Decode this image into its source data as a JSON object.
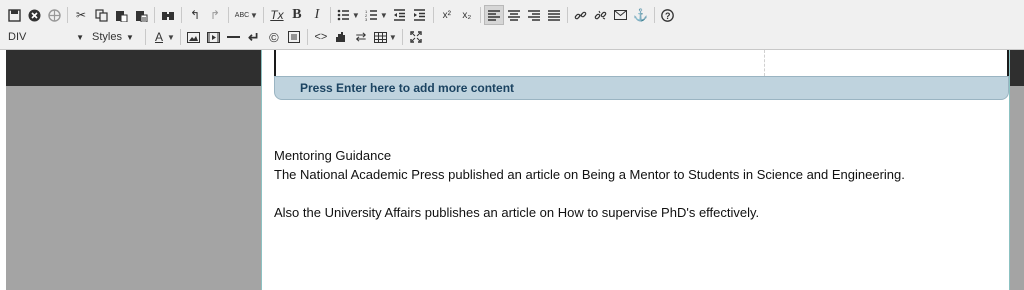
{
  "toolbar": {
    "format_combo": "DIV",
    "styles_combo": "Styles",
    "spellcheck_glyph": "ABC",
    "text_color_glyph": "A",
    "superscript_glyph": "x²",
    "subscript_glyph": "x₂",
    "bold_glyph": "B",
    "italic_glyph": "I",
    "clear_format_glyph": "Tx",
    "icons_row1": [
      "save-icon",
      "cancel-icon",
      "crosshair-icon",
      "cut-icon",
      "copy-icon",
      "paste-icon",
      "paste-text-icon",
      "find-icon",
      "undo-icon",
      "redo-icon",
      "spellcheck-icon",
      "remove-format-icon",
      "bold-icon",
      "italic-icon",
      "bulleted-list-icon",
      "numbered-list-icon",
      "decrease-indent-icon",
      "increase-indent-icon",
      "superscript-icon",
      "subscript-icon",
      "align-left-icon",
      "align-center-icon",
      "align-right-icon",
      "justify-icon",
      "link-icon",
      "unlink-icon",
      "email-icon",
      "anchor-icon",
      "help-icon"
    ],
    "icons_row2": [
      "text-color-icon",
      "image-icon",
      "media-icon",
      "horizontal-line-icon",
      "line-break-icon",
      "copyright-icon",
      "special-char-icon",
      "source-icon",
      "insert-widget-icon",
      "direction-icon",
      "table-icon",
      "maximize-icon"
    ]
  },
  "editor": {
    "enter_bar_text": "Press Enter here to add more content",
    "paragraphs": [
      "Mentoring Guidance",
      "The National Academic Press published an article on Being a Mentor to Students in Science and Engineering.",
      "Also the University Affairs publishes an article on How to supervise PhD's effectively."
    ]
  },
  "colors": {
    "toolbar_bg": "#f0f0f0",
    "left_panel": "#a4a4a4",
    "enter_bar": "#bfd3de",
    "enter_text": "#1b4361",
    "editor_border": "#8cc2c2"
  }
}
